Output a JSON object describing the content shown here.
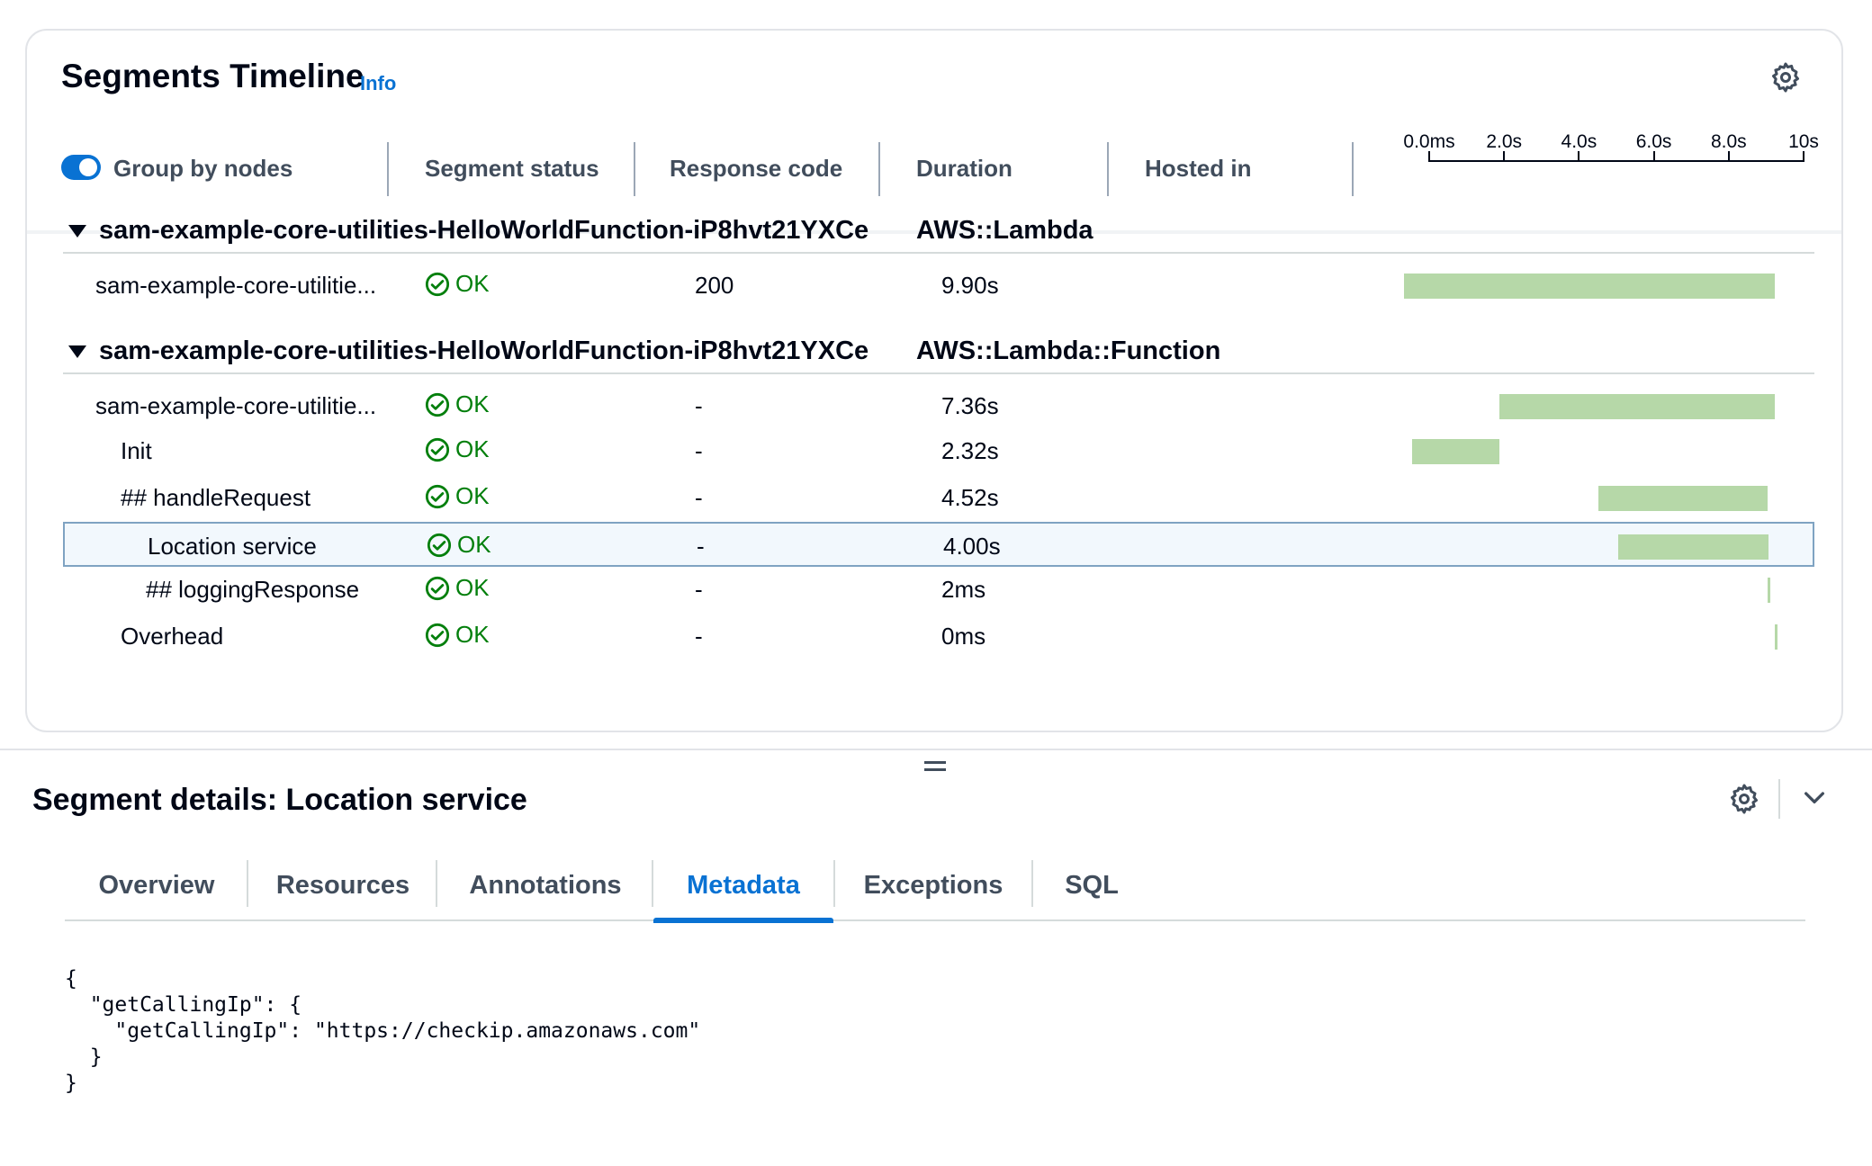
{
  "timeline": {
    "title": "Segments Timeline",
    "info_label": "Info",
    "group_toggle_label": "Group by nodes",
    "columns": [
      "Segment status",
      "Response code",
      "Duration",
      "Hosted in"
    ],
    "ticks": [
      "0.0ms",
      "2.0s",
      "4.0s",
      "6.0s",
      "8.0s",
      "10s"
    ],
    "axis_max_s": 10,
    "groups": [
      {
        "name": "sam-example-core-utilities-HelloWorldFunction-iP8hvt21YXCe",
        "type": "AWS::Lambda",
        "rows": [
          {
            "name": "sam-example-core-utilitie...",
            "status": "OK",
            "code": "200",
            "duration": "9.90s",
            "start_s": 0.0,
            "dur_s": 9.9
          }
        ]
      },
      {
        "name": "sam-example-core-utilities-HelloWorldFunction-iP8hvt21YXCe",
        "type": "AWS::Lambda::Function",
        "rows": [
          {
            "name": "sam-example-core-utilitie...",
            "status": "OK",
            "code": "-",
            "duration": "7.36s",
            "start_s": 2.54,
            "dur_s": 7.36
          },
          {
            "name": "Init",
            "status": "OK",
            "code": "-",
            "duration": "2.32s",
            "start_s": 0.22,
            "dur_s": 2.32
          },
          {
            "name": "## handleRequest",
            "status": "OK",
            "code": "-",
            "duration": "4.52s",
            "start_s": 5.2,
            "dur_s": 4.52
          },
          {
            "name": "Location service",
            "status": "OK",
            "code": "-",
            "duration": "4.00s",
            "start_s": 5.68,
            "dur_s": 4.0,
            "selected": true
          },
          {
            "name": "## loggingResponse",
            "status": "OK",
            "code": "-",
            "duration": "2ms",
            "start_s": 9.72,
            "dur_s": 0.002
          },
          {
            "name": "Overhead",
            "status": "OK",
            "code": "-",
            "duration": "0ms",
            "start_s": 9.9,
            "dur_s": 0.0
          }
        ]
      }
    ]
  },
  "details": {
    "title": "Segment details: Location service",
    "tabs": [
      "Overview",
      "Resources",
      "Annotations",
      "Metadata",
      "Exceptions",
      "SQL"
    ],
    "active_tab": "Metadata",
    "metadata_json": "{\n  \"getCallingIp\": {\n    \"getCallingIp\": \"https://checkip.amazonaws.com\"\n  }\n}"
  },
  "colors": {
    "accent": "#0972d3",
    "ok_green": "#037f0c",
    "bar_green": "#b6d8a8"
  },
  "icons": {
    "settings": "gear-icon",
    "status_ok": "check-circle-icon",
    "collapse": "caret-down-icon",
    "panel_toggle": "chevron-down-icon"
  }
}
